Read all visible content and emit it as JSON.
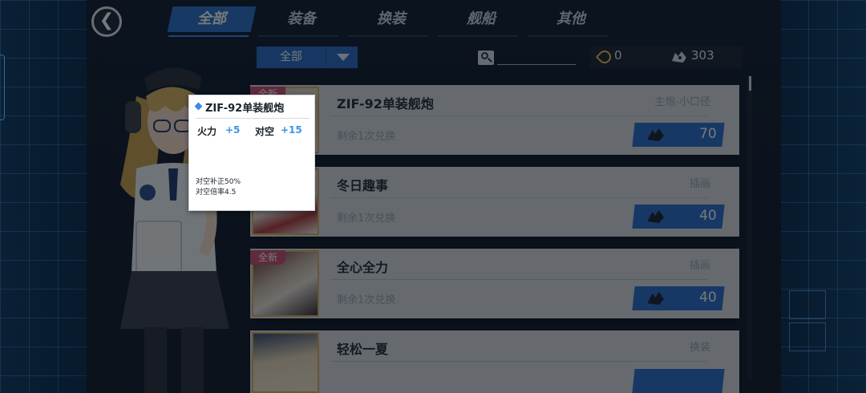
{
  "tabs": [
    {
      "label": "全部",
      "active": true
    },
    {
      "label": "装备",
      "active": false
    },
    {
      "label": "换装",
      "active": false
    },
    {
      "label": "舰船",
      "active": false
    },
    {
      "label": "其他",
      "active": false
    }
  ],
  "filter": {
    "selected": "全部"
  },
  "currency": {
    "pin_count": "0",
    "core_count": "303"
  },
  "items": [
    {
      "name": "ZIF-92单装舰炮",
      "category": "主炮-小口径",
      "remaining": "剩余1次兑换",
      "price": "70",
      "new_tag": "全新"
    },
    {
      "name": "冬日趣事",
      "category": "插画",
      "remaining": "剩余1次兑换",
      "price": "40",
      "new_tag": ""
    },
    {
      "name": "全心全力",
      "category": "插画",
      "remaining": "剩余1次兑换",
      "price": "40",
      "new_tag": "全新"
    },
    {
      "name": "轻松一夏",
      "category": "换装",
      "remaining": "",
      "price": "",
      "new_tag": ""
    }
  ],
  "tooltip": {
    "title": "ZIF-92单装舰炮",
    "stat1_label": "火力",
    "stat1_value": "+5",
    "stat2_label": "对空",
    "stat2_value": "+15",
    "note1": "对空补正50%",
    "note2": "对空倍率4.5"
  },
  "colors": {
    "accent": "#2c6fc6",
    "tab_active": "#2c6fc6",
    "new_tag": "#c9506e",
    "stat_value": "#3b95e6"
  }
}
